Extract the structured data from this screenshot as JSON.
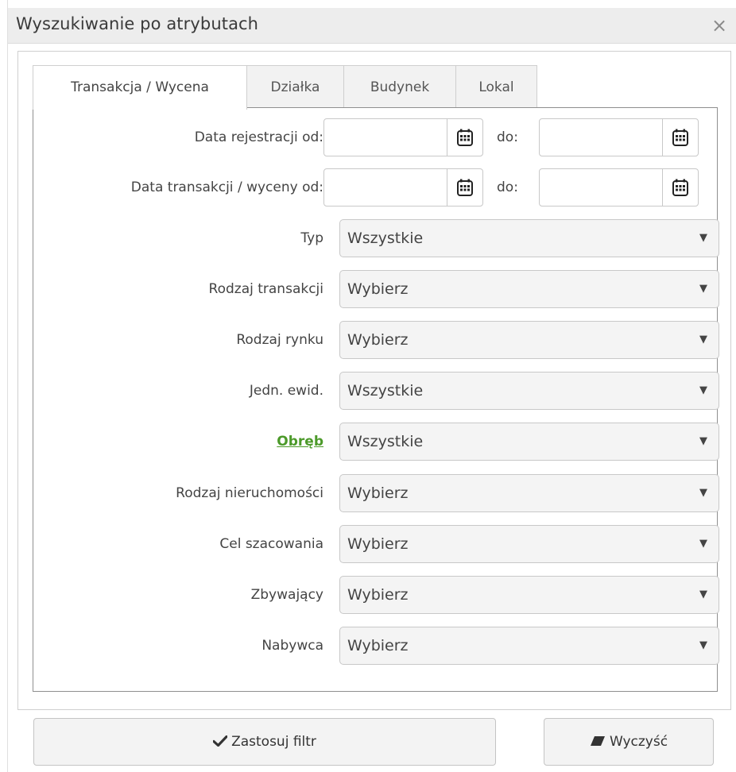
{
  "dialog": {
    "title": "Wyszukiwanie po atrybutach",
    "close_label": "×"
  },
  "tabs": [
    {
      "label": "Transakcja / Wycena",
      "active": true
    },
    {
      "label": "Działka",
      "active": false
    },
    {
      "label": "Budynek",
      "active": false
    },
    {
      "label": "Lokal",
      "active": false
    }
  ],
  "dates": {
    "registration_from_label": "Data rejestracji od:",
    "transaction_from_label": "Data transakcji / wyceny od:",
    "to_label": "do:",
    "registration_from_value": "",
    "registration_to_value": "",
    "transaction_from_value": "",
    "transaction_to_value": ""
  },
  "filters": [
    {
      "label": "Typ",
      "value": "Wszystkie"
    },
    {
      "label": "Rodzaj transakcji",
      "value": "Wybierz"
    },
    {
      "label": "Rodzaj rynku",
      "value": "Wybierz"
    },
    {
      "label": "Jedn. ewid.",
      "value": "Wszystkie"
    },
    {
      "label": "Obręb",
      "value": "Wszystkie"
    },
    {
      "label": "Rodzaj nieruchomości",
      "value": "Wybierz"
    },
    {
      "label": "Cel szacowania",
      "value": "Wybierz"
    },
    {
      "label": "Zbywający",
      "value": "Wybierz"
    },
    {
      "label": "Nabywca",
      "value": "Wybierz"
    }
  ],
  "caret": "▼",
  "buttons": {
    "apply_label": "Zastosuj filtr",
    "apply_icon": "check-icon",
    "clear_label": "Wyczyść",
    "clear_icon": "eraser-icon"
  },
  "colors": {
    "link_green": "#4c9a2a",
    "titlebar": "#ededed"
  }
}
